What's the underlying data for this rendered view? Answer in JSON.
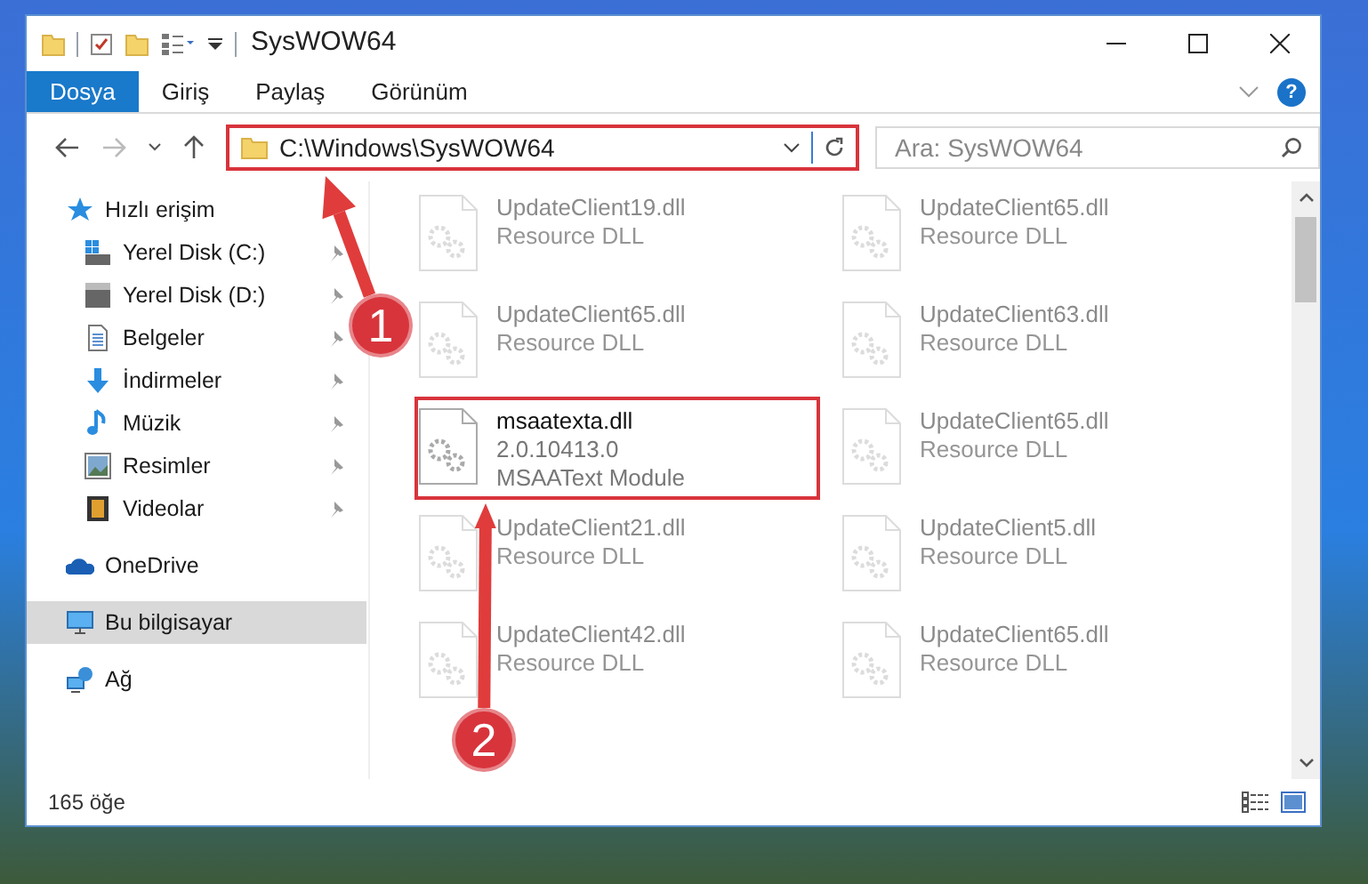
{
  "window": {
    "title": "SysWOW64"
  },
  "help_button": {
    "label": "?"
  },
  "ribbon_tabs": [
    {
      "label": "Dosya",
      "selected": true
    },
    {
      "label": "Giriş",
      "selected": false
    },
    {
      "label": "Paylaş",
      "selected": false
    },
    {
      "label": "Görünüm",
      "selected": false
    }
  ],
  "address_bar": {
    "path": "C:\\Windows\\SysWOW64",
    "highlighted": true
  },
  "search": {
    "placeholder": "Ara: SysWOW64"
  },
  "navigation": [
    {
      "label": "Hızlı erişim",
      "kind": "star",
      "selected": false,
      "children": [
        {
          "label": "Yerel Disk (C:)",
          "kind": "drive-windows",
          "pinned": true
        },
        {
          "label": "Yerel Disk (D:)",
          "kind": "drive",
          "pinned": true
        },
        {
          "label": "Belgeler",
          "kind": "document",
          "pinned": true
        },
        {
          "label": "İndirmeler",
          "kind": "download",
          "pinned": true
        },
        {
          "label": "Müzik",
          "kind": "music",
          "pinned": true
        },
        {
          "label": "Resimler",
          "kind": "picture",
          "pinned": true
        },
        {
          "label": "Videolar",
          "kind": "film",
          "pinned": true
        }
      ]
    },
    {
      "label": "OneDrive",
      "kind": "cloud",
      "selected": false
    },
    {
      "label": "Bu bilgisayar",
      "kind": "monitor",
      "selected": true
    },
    {
      "label": "Ağ",
      "kind": "network",
      "selected": false
    }
  ],
  "files": [
    {
      "name": "UpdateClient19.dll",
      "details": [
        "Resource DLL"
      ],
      "blurred": true,
      "highlighted": false
    },
    {
      "name": "UpdateClient65.dll",
      "details": [
        "Resource DLL"
      ],
      "blurred": true,
      "highlighted": false
    },
    {
      "name": "UpdateClient65.dll",
      "details": [
        "Resource DLL"
      ],
      "blurred": true,
      "highlighted": false
    },
    {
      "name": "UpdateClient63.dll",
      "details": [
        "Resource DLL"
      ],
      "blurred": true,
      "highlighted": false
    },
    {
      "name": "msaatexta.dll",
      "details": [
        "2.0.10413.0",
        "MSAAText Module"
      ],
      "blurred": false,
      "highlighted": true
    },
    {
      "name": "UpdateClient65.dll",
      "details": [
        "Resource DLL"
      ],
      "blurred": true,
      "highlighted": false
    },
    {
      "name": "UpdateClient21.dll",
      "details": [
        "Resource DLL"
      ],
      "blurred": true,
      "highlighted": false
    },
    {
      "name": "UpdateClient5.dll",
      "details": [
        "Resource DLL"
      ],
      "blurred": true,
      "highlighted": false
    },
    {
      "name": "UpdateClient42.dll",
      "details": [
        "Resource DLL"
      ],
      "blurred": true,
      "highlighted": false
    },
    {
      "name": "UpdateClient65.dll",
      "details": [
        "Resource DLL"
      ],
      "blurred": true,
      "highlighted": false
    }
  ],
  "annotations": [
    {
      "label": "1"
    },
    {
      "label": "2"
    }
  ],
  "status_bar": {
    "item_count": "165 öğe"
  }
}
